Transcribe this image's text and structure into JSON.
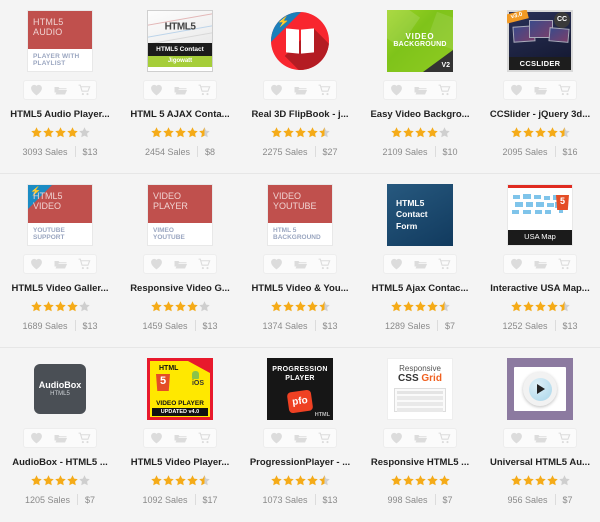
{
  "page": {
    "background": "#f4f4f4",
    "columns": 5,
    "rows": 3,
    "star_color": "#f5ab18",
    "star_empty_color": "#cfcfcf",
    "actions": [
      {
        "name": "favorite-icon",
        "label": "Add to favorites"
      },
      {
        "name": "collection-icon",
        "label": "Add to collection"
      },
      {
        "name": "cart-icon",
        "label": "Add to cart"
      }
    ],
    "sales_suffix": "Sales"
  },
  "items": [
    {
      "title": "HTML5 Audio Player...",
      "rating": 4,
      "sales": "3093 Sales",
      "price": "$13",
      "thumb_class": "t1",
      "thumb_text": {
        "line1": "HTML5",
        "line2": "AUDIO",
        "line3": "PLAYER WITH",
        "line4": "PLAYLIST"
      }
    },
    {
      "title": "HTML 5 AJAX Conta...",
      "rating": 4.5,
      "sales": "2454 Sales",
      "price": "$8",
      "thumb_class": "t2",
      "thumb_text": {
        "line1": "HTML5",
        "line2": "HTML5 Contact",
        "line3": "Jigowatt"
      }
    },
    {
      "title": "Real 3D FlipBook - j...",
      "rating": 4.5,
      "sales": "2275 Sales",
      "price": "$27",
      "thumb_class": "t3",
      "thumb_text": {
        "line1": "",
        "line2": "",
        "line3": "",
        "line4": ""
      }
    },
    {
      "title": "Easy Video Backgro...",
      "rating": 4,
      "sales": "2109 Sales",
      "price": "$10",
      "thumb_class": "t4",
      "thumb_text": {
        "line1": "VIDEO",
        "line2": "BACKGROUND",
        "line3": "V2"
      }
    },
    {
      "title": "CCSlider - jQuery 3d...",
      "rating": 4.5,
      "sales": "2095 Sales",
      "price": "$16",
      "thumb_class": "t5",
      "thumb_text": {
        "line1": "v3.0",
        "line2": "CC",
        "line3": "CCSLIDER"
      }
    },
    {
      "title": "HTML5 Video Galler...",
      "rating": 4,
      "sales": "1689 Sales",
      "price": "$13",
      "thumb_class": "t6",
      "thumb_text": {
        "line1": "HTML5",
        "line2": "VIDEO",
        "line3": "YOUTUBE",
        "line4": "SUPPORT"
      }
    },
    {
      "title": "Responsive Video G...",
      "rating": 4,
      "sales": "1459 Sales",
      "price": "$13",
      "thumb_class": "t7",
      "thumb_text": {
        "line1": "VIDEO",
        "line2": "PLAYER",
        "line3": "VIMEO",
        "line4": "YOUTUBE"
      }
    },
    {
      "title": "HTML5 Video & You...",
      "rating": 4.5,
      "sales": "1374 Sales",
      "price": "$13",
      "thumb_class": "t8",
      "thumb_text": {
        "line1": "VIDEO",
        "line2": "YOUTUBE",
        "line3": "HTML 5",
        "line4": "BACKGROUND"
      }
    },
    {
      "title": "HTML5 Ajax Contac...",
      "rating": 4.5,
      "sales": "1289 Sales",
      "price": "$7",
      "thumb_class": "t9",
      "thumb_text": {
        "line1": "HTML5",
        "line2": "Contact",
        "line3": "Form"
      }
    },
    {
      "title": "Interactive USA Map...",
      "rating": 4.5,
      "sales": "1252 Sales",
      "price": "$13",
      "thumb_class": "t10",
      "thumb_text": {
        "line1": "USA Map",
        "line2": "5"
      }
    },
    {
      "title": "AudioBox - HTML5 ...",
      "rating": 4,
      "sales": "1205 Sales",
      "price": "$7",
      "thumb_class": "t11",
      "thumb_text": {
        "line1": "AudioBox",
        "line2": "HTML5"
      }
    },
    {
      "title": "HTML5 Video Player...",
      "rating": 4.5,
      "sales": "1092 Sales",
      "price": "$17",
      "thumb_class": "t12",
      "thumb_text": {
        "line1": "HTML",
        "line2": "5",
        "line3": "iOS",
        "line4": "VIDEO PLAYER",
        "line5": "UPDATED v4.0"
      }
    },
    {
      "title": "ProgressionPlayer - ...",
      "rating": 4.5,
      "sales": "1073 Sales",
      "price": "$13",
      "thumb_class": "t13",
      "thumb_text": {
        "line1": "PROGRESSION",
        "line2": "PLAYER",
        "line3": "pfo",
        "line4": "HTML"
      }
    },
    {
      "title": "Responsive HTML5 ...",
      "rating": 5,
      "sales": "998 Sales",
      "price": "$7",
      "thumb_class": "t14",
      "thumb_text": {
        "line1": "Responsive",
        "line2": "CSS ",
        "line3": "Grid"
      }
    },
    {
      "title": "Universal HTML5 Au...",
      "rating": 4,
      "sales": "956 Sales",
      "price": "$7",
      "thumb_class": "t15",
      "thumb_text": {
        "line1": "",
        "line2": ""
      }
    }
  ]
}
